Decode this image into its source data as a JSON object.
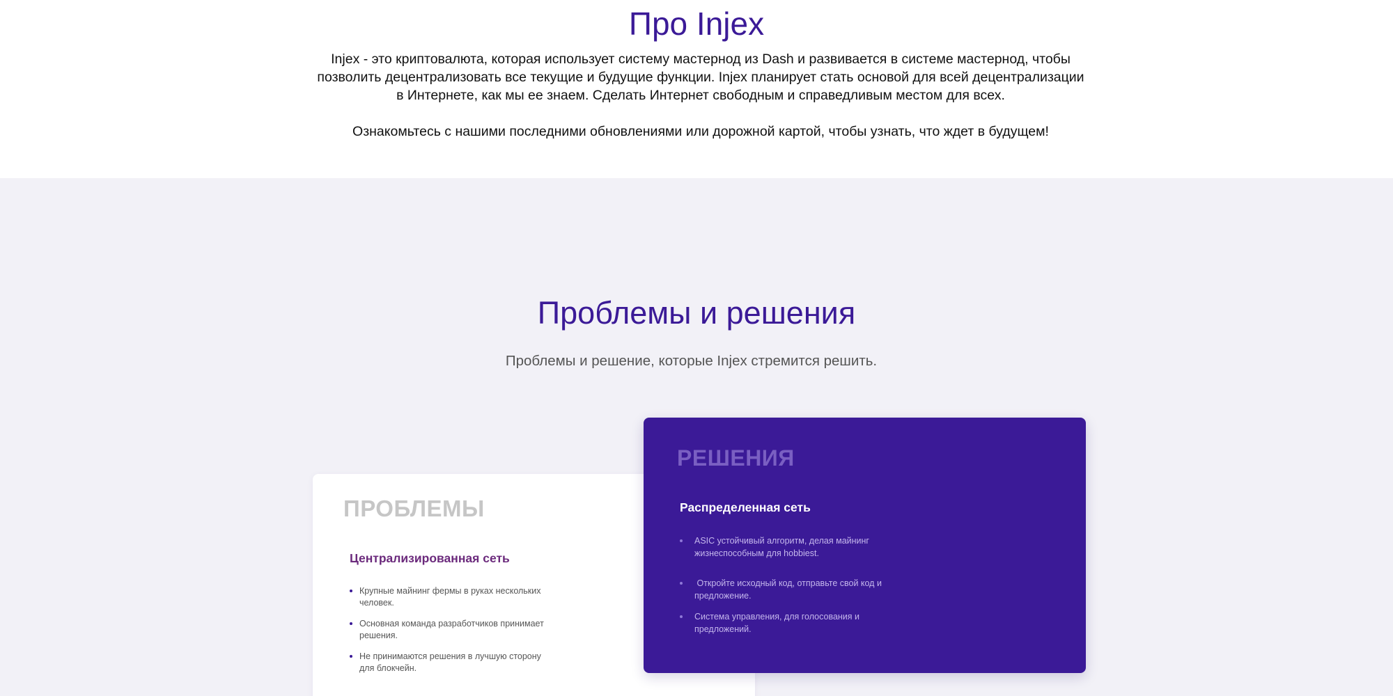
{
  "about": {
    "title": "Про Injex",
    "paragraph1": "Injex - это криптовалюта, которая использует систему мастернод из Dash и развивается в системе мастернод, чтобы позволить децентрализовать все текущие и будущие функции. Injex планирует стать основой для всей децентрализации в Интернете, как мы ее знаем. Сделать Интернет свободным и справедливым местом для всех.",
    "paragraph2": "Ознакомьтесь с нашими последними обновлениями или дорожной картой, чтобы узнать, что ждет в будущем!"
  },
  "problems_solutions": {
    "title": "Проблемы и решения",
    "subtitle": "Проблемы и решение, которые Injex стремится решить.",
    "problems": {
      "heading": "ПРОБЛЕМЫ",
      "subheading": "Централизированная сеть",
      "items": [
        "Крупные майнинг фермы в руках нескольких человек.",
        "Основная команда разработчиков принимает решения.",
        "Не принимаются решения в лучшую сторону для блокчейн."
      ]
    },
    "solutions": {
      "heading": "РЕШЕНИЯ",
      "subheading": "Распределенная сеть",
      "items": [
        "ASIC устойчивый алгоритм, делая майнинг жизнеспособным для hobbiest.",
        " Откройте исходный код, отправьте свой код и предложение.",
        "Система управления, для голосования и предложений."
      ]
    }
  },
  "colors": {
    "accent": "#3b1a97",
    "section_bg": "#f2f1f7",
    "problems_subheading": "#6b2a7c"
  }
}
